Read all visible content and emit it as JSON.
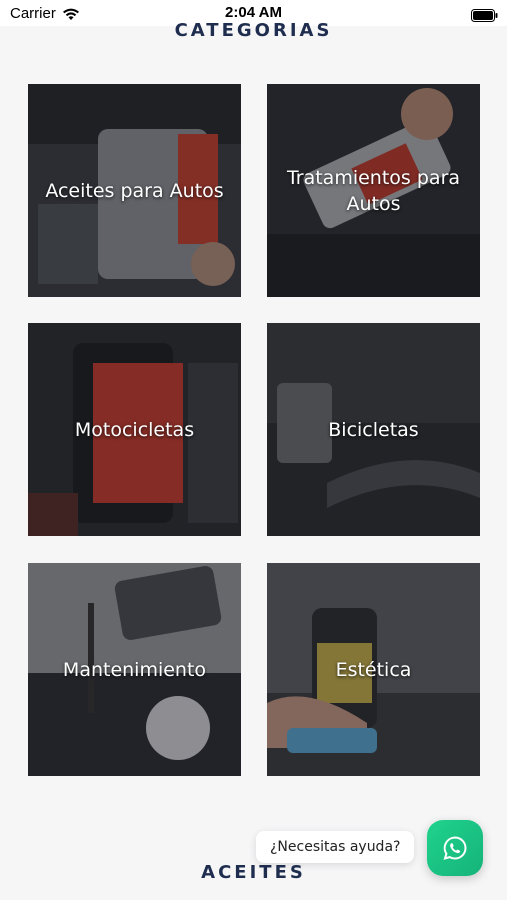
{
  "status_bar": {
    "carrier": "Carrier",
    "time": "2:04 AM",
    "wifi_icon": "wifi-icon",
    "battery_icon": "battery-icon"
  },
  "section_top": {
    "title": "CATEGORIAS"
  },
  "categories": [
    {
      "label": "Aceites para Autos"
    },
    {
      "label": "Tratamientos para Autos"
    },
    {
      "label": "Motocicletas"
    },
    {
      "label": "Bicicletas"
    },
    {
      "label": "Mantenimiento"
    },
    {
      "label": "Estética"
    }
  ],
  "help": {
    "bubble_text": "¿Necesitas ayuda?",
    "button_icon": "whatsapp-icon",
    "button_color": "#1ec785"
  },
  "section_bottom": {
    "title": "ACEITES"
  }
}
